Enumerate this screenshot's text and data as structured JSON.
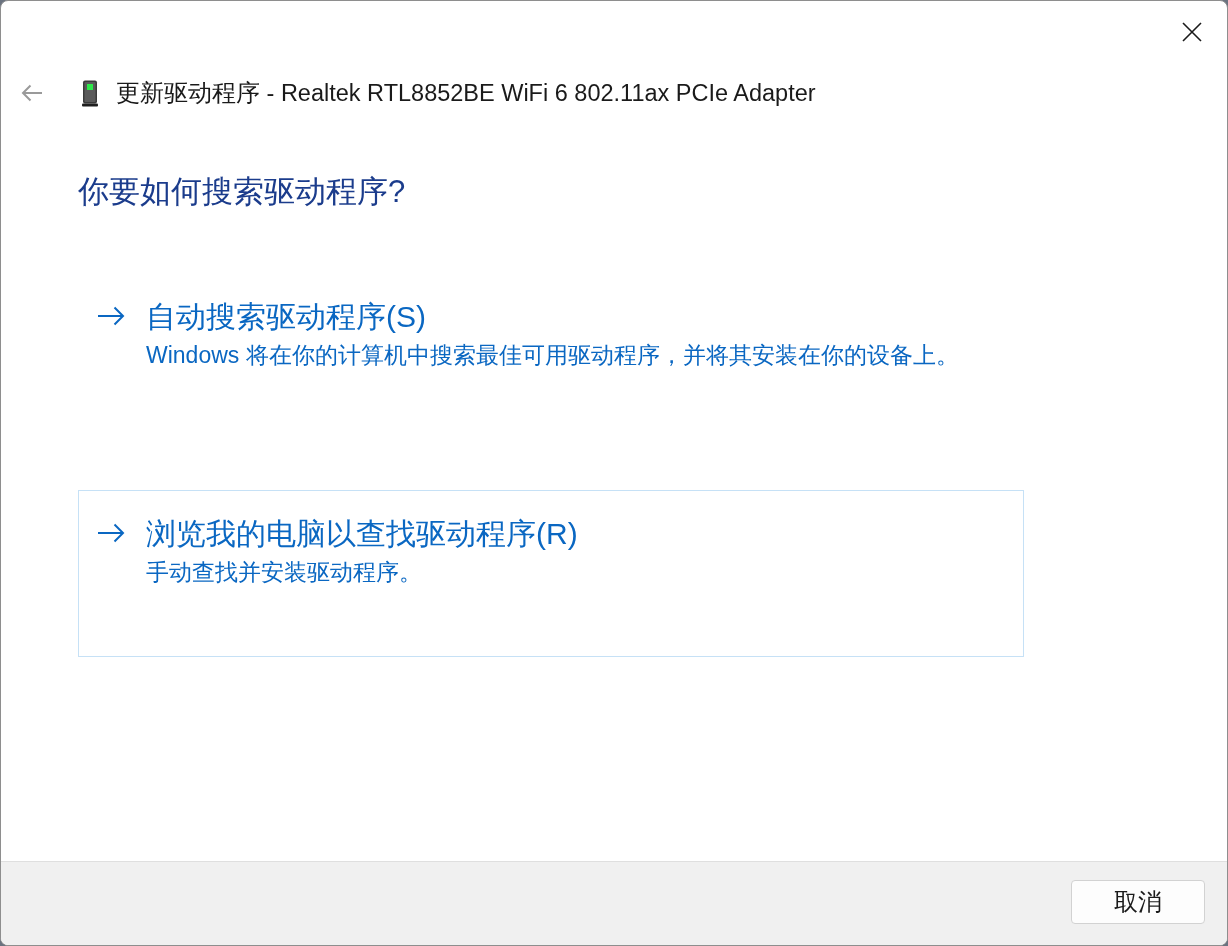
{
  "window": {
    "title": "更新驱动程序 - Realtek RTL8852BE WiFi 6 802.11ax PCIe Adapter"
  },
  "heading": "你要如何搜索驱动程序?",
  "options": [
    {
      "title": "自动搜索驱动程序(S)",
      "description": "Windows 将在你的计算机中搜索最佳可用驱动程序，并将其安装在你的设备上。",
      "selected": false
    },
    {
      "title": "浏览我的电脑以查找驱动程序(R)",
      "description": "手动查找并安装驱动程序。",
      "selected": true
    }
  ],
  "buttons": [
    {
      "label": "取消"
    }
  ]
}
